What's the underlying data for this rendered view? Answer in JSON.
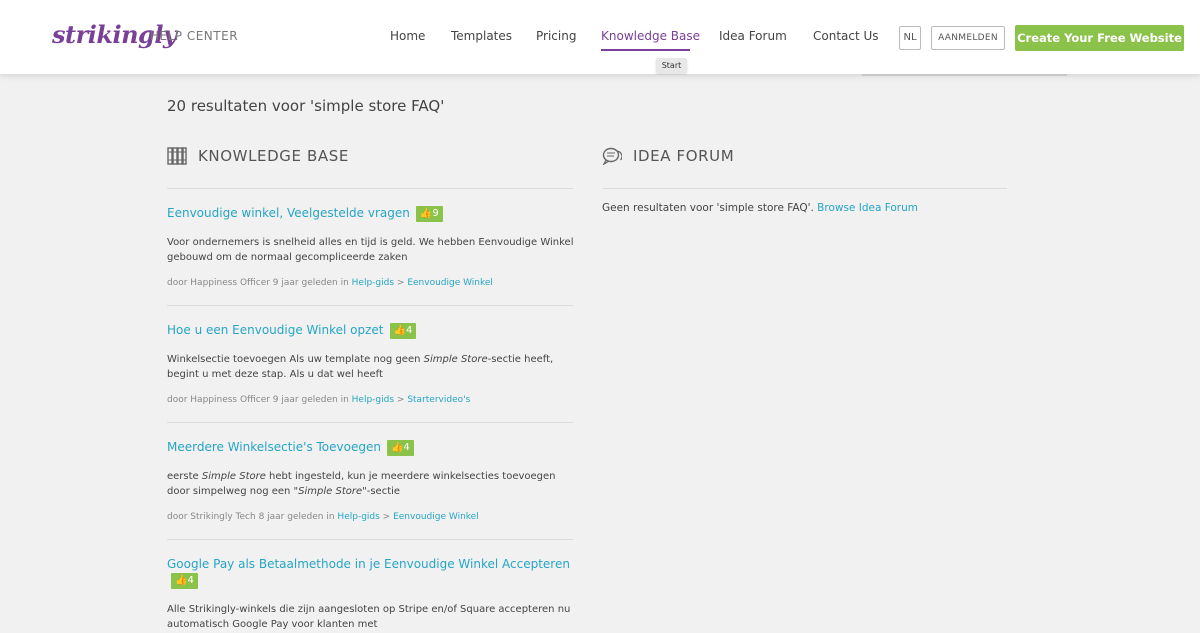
{
  "header": {
    "logo": "strikingly",
    "help_center": "HELP CENTER",
    "nav": [
      "Home",
      "Templates",
      "Pricing",
      "Knowledge Base",
      "Idea Forum",
      "Contact Us"
    ],
    "active_nav": "Knowledge Base",
    "lang": "NL",
    "login": "AANMELDEN",
    "cta": "Create Your Free Website",
    "tooltip": "Start",
    "accent": "#7a3f96",
    "cta_color": "#8bc34a"
  },
  "search": {
    "results_title": "20 resultaten voor 'simple store FAQ'"
  },
  "knowledge_base": {
    "heading": "KNOWLEDGE BASE",
    "icon": "books-icon",
    "articles": [
      {
        "title": "Eenvoudige winkel, Veelgestelde vragen",
        "votes": "9",
        "excerpt_parts": [
          "Voor ondernemers is snelheid alles en tijd is geld. We hebben Eenvoudige Winkel gebouwd om de normaal gecompliceerde zaken"
        ],
        "meta": "door Happiness Officer 9 jaar geleden in ",
        "crumb1": "Help-gids",
        "crumb_sep": " > ",
        "crumb2": "Eenvoudige Winkel"
      },
      {
        "title": "Hoe u een Eenvoudige Winkel opzet",
        "votes": "4",
        "excerpt_a": "Winkelsectie toevoegen Als uw template nog geen ",
        "excerpt_em": "Simple Store",
        "excerpt_b": "-sectie heeft, begint u met deze stap. Als u dat wel heeft",
        "meta": "door Happiness Officer 9 jaar geleden in ",
        "crumb1": "Help-gids",
        "crumb_sep": " > ",
        "crumb2": "Startervideo's"
      },
      {
        "title": "Meerdere Winkelsectie's Toevoegen",
        "votes": "4",
        "excerpt_a": "eerste ",
        "excerpt_em": "Simple Store",
        "excerpt_b": " hebt ingesteld, kun je meerdere winkelsecties toevoegen door simpelweg nog een \"",
        "excerpt_em2": "Simple Store",
        "excerpt_c": "\"-sectie",
        "meta": "door Strikingly Tech 8 jaar geleden in ",
        "crumb1": "Help-gids",
        "crumb_sep": " > ",
        "crumb2": "Eenvoudige Winkel"
      },
      {
        "title": "Google Pay als Betaalmethode in je Eenvoudige Winkel Accepteren",
        "votes": "4",
        "excerpt": "Alle Strikingly-winkels die zijn aangesloten op Stripe en/of Square accepteren nu automatisch Google Pay voor klanten met"
      }
    ]
  },
  "idea_forum": {
    "heading": "IDEA FORUM",
    "icon": "chat-bubbles-icon",
    "no_results": "Geen resultaten voor 'simple store FAQ'. ",
    "browse_link": "Browse Idea Forum"
  }
}
